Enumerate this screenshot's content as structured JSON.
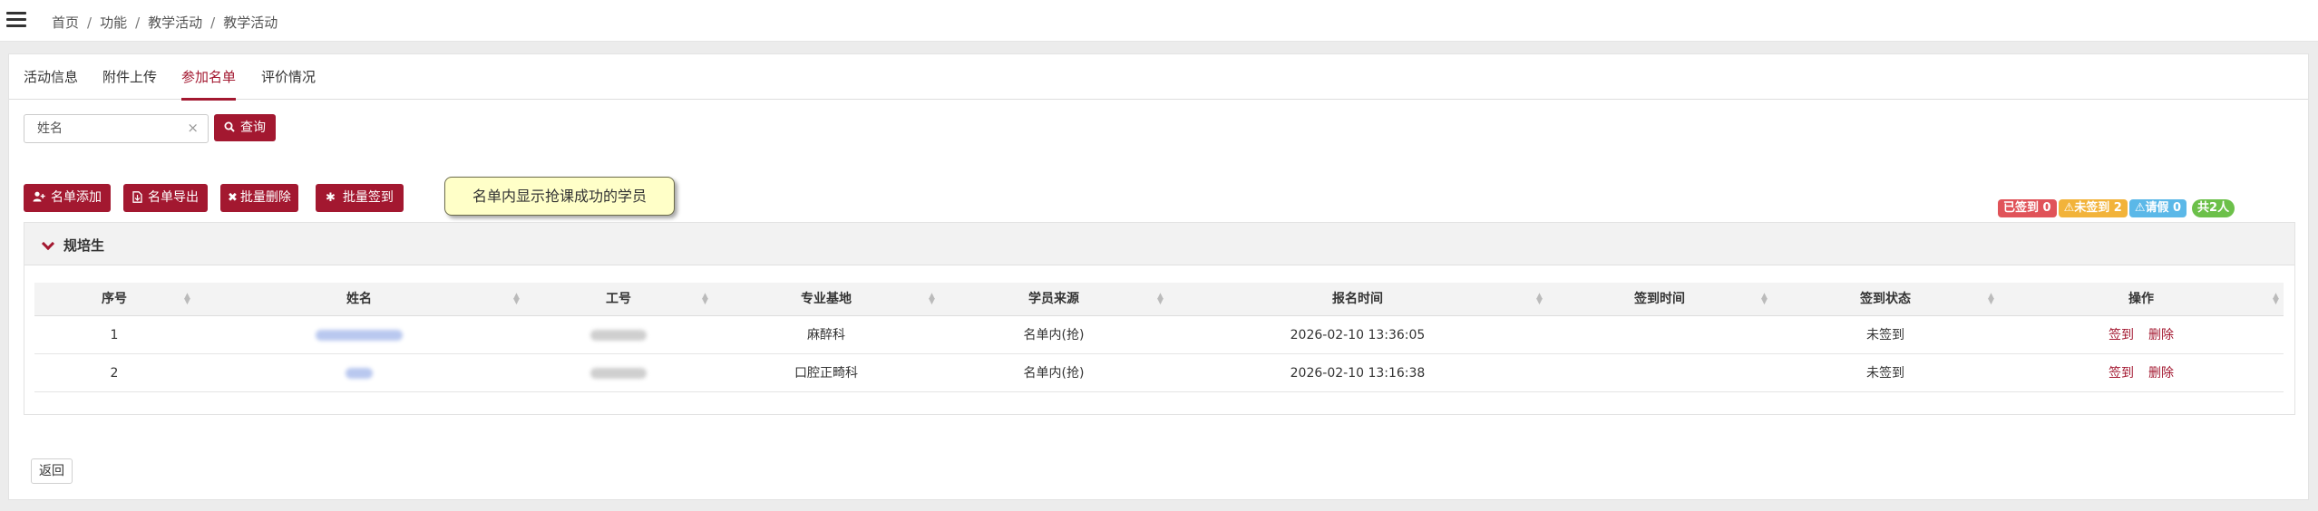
{
  "breadcrumb": [
    "首页",
    "功能",
    "教学活动",
    "教学活动"
  ],
  "tabs": [
    {
      "label": "活动信息",
      "active": false
    },
    {
      "label": "附件上传",
      "active": false
    },
    {
      "label": "参加名单",
      "active": true
    },
    {
      "label": "评价情况",
      "active": false
    }
  ],
  "search": {
    "placeholder": "姓名",
    "value": "",
    "clear_glyph": "×",
    "button_label": "查询"
  },
  "actions": {
    "add_label": "名单添加",
    "export_label": "名单导出",
    "batch_delete_label": "批量删除",
    "batch_signin_label": "批量签到"
  },
  "tooltip": "名单内显示抢课成功的学员",
  "badges": {
    "signed": "已签到 0",
    "unsigned": "⚠未签到 2",
    "leave": "⚠请假 0",
    "total": "共2人"
  },
  "colors": {
    "accent": "#a31830",
    "signed": "#e05359",
    "unsigned": "#f2b33a",
    "leave": "#5bb8e8",
    "total": "#6cc04a"
  },
  "panel": {
    "title": "规培生"
  },
  "table": {
    "headers": [
      "序号",
      "姓名",
      "工号",
      "专业基地",
      "学员来源",
      "报名时间",
      "签到时间",
      "签到状态",
      "操作"
    ],
    "rows": [
      {
        "index": "1",
        "base": "麻醉科",
        "source": "名单内(抢)",
        "reg_time": "2026-02-10 13:36:05",
        "signin_time": "",
        "status": "未签到",
        "signin_link": "签到",
        "delete_link": "删除"
      },
      {
        "index": "2",
        "base": "口腔正畸科",
        "source": "名单内(抢)",
        "reg_time": "2026-02-10 13:16:38",
        "signin_time": "",
        "status": "未签到",
        "signin_link": "签到",
        "delete_link": "删除"
      }
    ]
  },
  "back_label": "返回",
  "icons": {
    "menu": "hamburger-icon",
    "search": "search-icon",
    "add": "user-plus-icon",
    "export": "file-export-icon",
    "delete": "times-icon",
    "signin": "gear-icon",
    "collapse": "chevron-down-icon"
  }
}
